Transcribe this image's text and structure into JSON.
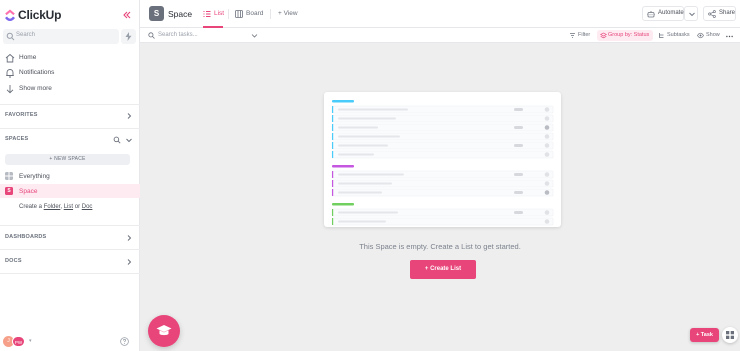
{
  "app": {
    "name": "ClickUp",
    "brand_color": "#e8457a"
  },
  "sidebar": {
    "search_placeholder": "Search",
    "nav": [
      {
        "label": "Home",
        "icon": "home-icon"
      },
      {
        "label": "Notifications",
        "icon": "bell-icon"
      },
      {
        "label": "Show more",
        "icon": "arrow-down-icon"
      }
    ],
    "favorites_label": "FAVORITES",
    "spaces_label": "SPACES",
    "new_space_label": "+ NEW SPACE",
    "spaces": [
      {
        "label": "Everything",
        "icon": "grid-icon"
      },
      {
        "label": "Space",
        "badge": "S",
        "active": true
      }
    ],
    "create": {
      "prefix": "Create a ",
      "folder": "Folder",
      "sep1": ", ",
      "list": "List",
      "sep2": " or ",
      "doc": "Doc"
    },
    "dashboards_label": "DASHBOARDS",
    "docs_label": "DOCS",
    "footer": {
      "avatar_initial": "J",
      "avatar_badge": "PW"
    }
  },
  "header": {
    "space_badge": "S",
    "space_title": "Space",
    "tabs": [
      {
        "label": "List",
        "active": true
      },
      {
        "label": "Board",
        "active": false
      }
    ],
    "add_view_label": "+ View",
    "automate_label": "Automate",
    "share_label": "Share"
  },
  "toolbar": {
    "search_placeholder": "Search tasks...",
    "filter_label": "Filter",
    "group_label": "Group by: Status",
    "subtasks_label": "Subtasks",
    "show_label": "Show"
  },
  "main": {
    "empty_text": "This Space is empty. Create a List to get started.",
    "create_list_label": "+ Create List",
    "illustration_groups": [
      {
        "color": "#49ccf9",
        "rows": 6
      },
      {
        "color": "#c456e0",
        "rows": 3
      },
      {
        "color": "#71cf5f",
        "rows": 2
      }
    ],
    "task_fab_label": "+ Task"
  }
}
